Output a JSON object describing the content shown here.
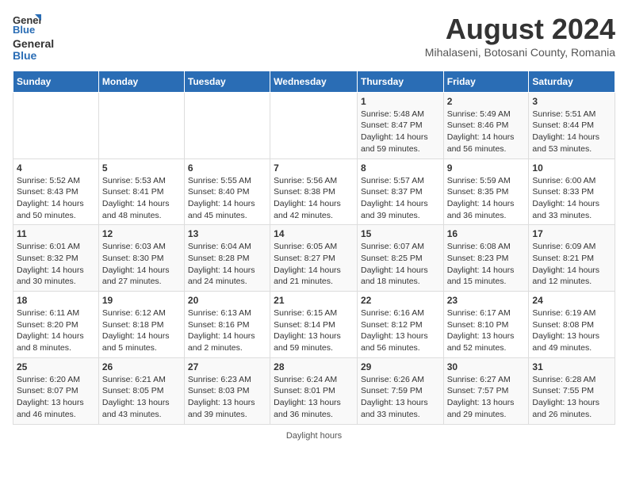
{
  "logo": {
    "general": "General",
    "blue": "Blue"
  },
  "title": "August 2024",
  "subtitle": "Mihalaseni, Botosani County, Romania",
  "headers": [
    "Sunday",
    "Monday",
    "Tuesday",
    "Wednesday",
    "Thursday",
    "Friday",
    "Saturday"
  ],
  "weeks": [
    [
      {
        "day": "",
        "info": ""
      },
      {
        "day": "",
        "info": ""
      },
      {
        "day": "",
        "info": ""
      },
      {
        "day": "",
        "info": ""
      },
      {
        "day": "1",
        "info": "Sunrise: 5:48 AM\nSunset: 8:47 PM\nDaylight: 14 hours and 59 minutes."
      },
      {
        "day": "2",
        "info": "Sunrise: 5:49 AM\nSunset: 8:46 PM\nDaylight: 14 hours and 56 minutes."
      },
      {
        "day": "3",
        "info": "Sunrise: 5:51 AM\nSunset: 8:44 PM\nDaylight: 14 hours and 53 minutes."
      }
    ],
    [
      {
        "day": "4",
        "info": "Sunrise: 5:52 AM\nSunset: 8:43 PM\nDaylight: 14 hours and 50 minutes."
      },
      {
        "day": "5",
        "info": "Sunrise: 5:53 AM\nSunset: 8:41 PM\nDaylight: 14 hours and 48 minutes."
      },
      {
        "day": "6",
        "info": "Sunrise: 5:55 AM\nSunset: 8:40 PM\nDaylight: 14 hours and 45 minutes."
      },
      {
        "day": "7",
        "info": "Sunrise: 5:56 AM\nSunset: 8:38 PM\nDaylight: 14 hours and 42 minutes."
      },
      {
        "day": "8",
        "info": "Sunrise: 5:57 AM\nSunset: 8:37 PM\nDaylight: 14 hours and 39 minutes."
      },
      {
        "day": "9",
        "info": "Sunrise: 5:59 AM\nSunset: 8:35 PM\nDaylight: 14 hours and 36 minutes."
      },
      {
        "day": "10",
        "info": "Sunrise: 6:00 AM\nSunset: 8:33 PM\nDaylight: 14 hours and 33 minutes."
      }
    ],
    [
      {
        "day": "11",
        "info": "Sunrise: 6:01 AM\nSunset: 8:32 PM\nDaylight: 14 hours and 30 minutes."
      },
      {
        "day": "12",
        "info": "Sunrise: 6:03 AM\nSunset: 8:30 PM\nDaylight: 14 hours and 27 minutes."
      },
      {
        "day": "13",
        "info": "Sunrise: 6:04 AM\nSunset: 8:28 PM\nDaylight: 14 hours and 24 minutes."
      },
      {
        "day": "14",
        "info": "Sunrise: 6:05 AM\nSunset: 8:27 PM\nDaylight: 14 hours and 21 minutes."
      },
      {
        "day": "15",
        "info": "Sunrise: 6:07 AM\nSunset: 8:25 PM\nDaylight: 14 hours and 18 minutes."
      },
      {
        "day": "16",
        "info": "Sunrise: 6:08 AM\nSunset: 8:23 PM\nDaylight: 14 hours and 15 minutes."
      },
      {
        "day": "17",
        "info": "Sunrise: 6:09 AM\nSunset: 8:21 PM\nDaylight: 14 hours and 12 minutes."
      }
    ],
    [
      {
        "day": "18",
        "info": "Sunrise: 6:11 AM\nSunset: 8:20 PM\nDaylight: 14 hours and 8 minutes."
      },
      {
        "day": "19",
        "info": "Sunrise: 6:12 AM\nSunset: 8:18 PM\nDaylight: 14 hours and 5 minutes."
      },
      {
        "day": "20",
        "info": "Sunrise: 6:13 AM\nSunset: 8:16 PM\nDaylight: 14 hours and 2 minutes."
      },
      {
        "day": "21",
        "info": "Sunrise: 6:15 AM\nSunset: 8:14 PM\nDaylight: 13 hours and 59 minutes."
      },
      {
        "day": "22",
        "info": "Sunrise: 6:16 AM\nSunset: 8:12 PM\nDaylight: 13 hours and 56 minutes."
      },
      {
        "day": "23",
        "info": "Sunrise: 6:17 AM\nSunset: 8:10 PM\nDaylight: 13 hours and 52 minutes."
      },
      {
        "day": "24",
        "info": "Sunrise: 6:19 AM\nSunset: 8:08 PM\nDaylight: 13 hours and 49 minutes."
      }
    ],
    [
      {
        "day": "25",
        "info": "Sunrise: 6:20 AM\nSunset: 8:07 PM\nDaylight: 13 hours and 46 minutes."
      },
      {
        "day": "26",
        "info": "Sunrise: 6:21 AM\nSunset: 8:05 PM\nDaylight: 13 hours and 43 minutes."
      },
      {
        "day": "27",
        "info": "Sunrise: 6:23 AM\nSunset: 8:03 PM\nDaylight: 13 hours and 39 minutes."
      },
      {
        "day": "28",
        "info": "Sunrise: 6:24 AM\nSunset: 8:01 PM\nDaylight: 13 hours and 36 minutes."
      },
      {
        "day": "29",
        "info": "Sunrise: 6:26 AM\nSunset: 7:59 PM\nDaylight: 13 hours and 33 minutes."
      },
      {
        "day": "30",
        "info": "Sunrise: 6:27 AM\nSunset: 7:57 PM\nDaylight: 13 hours and 29 minutes."
      },
      {
        "day": "31",
        "info": "Sunrise: 6:28 AM\nSunset: 7:55 PM\nDaylight: 13 hours and 26 minutes."
      }
    ]
  ],
  "footer": "Daylight hours"
}
